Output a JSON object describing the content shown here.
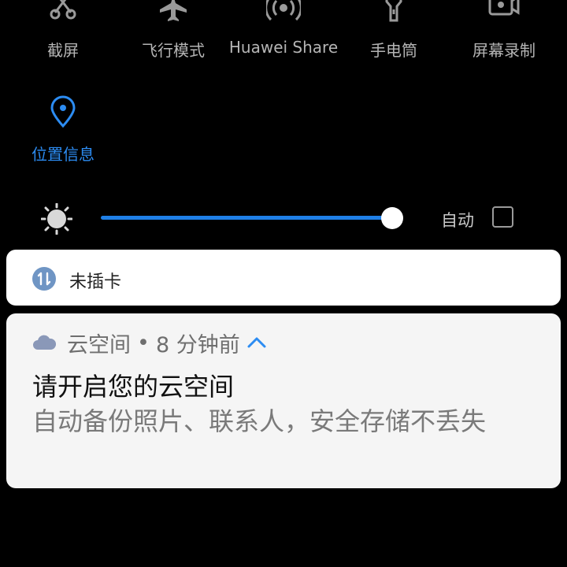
{
  "quick_settings": {
    "tiles": [
      {
        "label": "截屏",
        "icon": "screenshot-icon"
      },
      {
        "label": "飞行模式",
        "icon": "airplane-icon"
      },
      {
        "label": "Huawei Share",
        "icon": "huawei-share-icon"
      },
      {
        "label": "手电筒",
        "icon": "flashlight-icon"
      },
      {
        "label": "屏幕录制",
        "icon": "screen-record-icon"
      },
      {
        "label": "位置信息",
        "icon": "location-icon",
        "active": true
      }
    ],
    "active_color": "#2c8cf2"
  },
  "brightness": {
    "level": 0.99,
    "auto_label": "自动",
    "auto_checked": false,
    "track_color": "#1f7fe6"
  },
  "sim_notice": {
    "label": "未插卡",
    "icon": "data-transfer-icon"
  },
  "cloud_notification": {
    "app_name": "云空间",
    "separator": "•",
    "time": "8 分钟前",
    "title": "请开启您的云空间",
    "body": "自动备份照片、联系人，安全存储不丢失",
    "icon": "cloud-icon",
    "expand_icon": "chevron-up-icon"
  }
}
